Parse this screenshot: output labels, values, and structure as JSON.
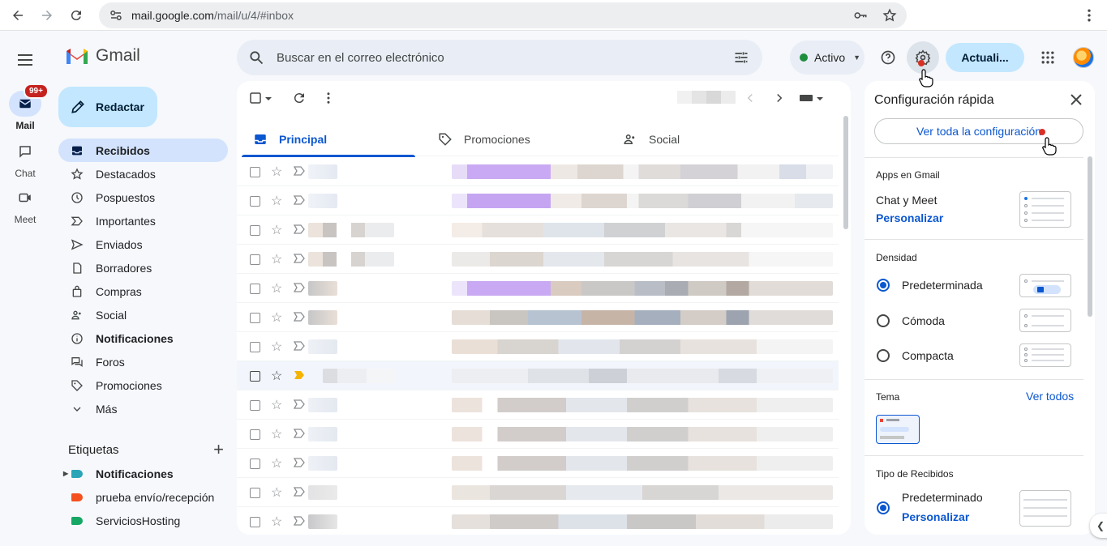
{
  "browser": {
    "url_host": "mail.google.com",
    "url_path": "/mail/u/4/#inbox"
  },
  "rail": {
    "mail_label": "Mail",
    "mail_badge": "99+",
    "chat_label": "Chat",
    "meet_label": "Meet"
  },
  "app": {
    "name": "Gmail",
    "compose_label": "Redactar"
  },
  "nav": {
    "items": [
      {
        "label": "Recibidos",
        "icon": "inbox-icon"
      },
      {
        "label": "Destacados",
        "icon": "star-icon"
      },
      {
        "label": "Pospuestos",
        "icon": "clock-icon"
      },
      {
        "label": "Importantes",
        "icon": "important-icon"
      },
      {
        "label": "Enviados",
        "icon": "send-icon"
      },
      {
        "label": "Borradores",
        "icon": "draft-icon"
      },
      {
        "label": "Compras",
        "icon": "shopping-bag-icon"
      },
      {
        "label": "Social",
        "icon": "people-icon"
      },
      {
        "label": "Notificaciones",
        "icon": "info-icon"
      },
      {
        "label": "Foros",
        "icon": "forum-icon"
      },
      {
        "label": "Promociones",
        "icon": "tag-icon"
      },
      {
        "label": "Más",
        "icon": "chevron-down-icon"
      }
    ]
  },
  "labels": {
    "heading": "Etiquetas",
    "items": [
      {
        "label": "Notificaciones",
        "color": "#2aa5b8"
      },
      {
        "label": "prueba envío/recepción",
        "color": "#f4511e"
      },
      {
        "label": "ServiciosHosting",
        "color": "#16a765"
      }
    ]
  },
  "search": {
    "placeholder": "Buscar en el correo electrónico"
  },
  "status": {
    "label": "Activo"
  },
  "header": {
    "upgrade_label": "Actuali..."
  },
  "tabs": [
    {
      "label": "Principal"
    },
    {
      "label": "Promociones"
    },
    {
      "label": "Social"
    }
  ],
  "quick_settings": {
    "title": "Configuración rápida",
    "see_all": "Ver toda la configuración",
    "apps_heading": "Apps en Gmail",
    "apps_text": "Chat y Meet",
    "apps_link": "Personalizar",
    "density_heading": "Densidad",
    "density_options": [
      "Predeterminada",
      "Cómoda",
      "Compacta"
    ],
    "density_selected": "Predeterminada",
    "theme_heading": "Tema",
    "theme_link": "Ver todos",
    "inbox_type_heading": "Tipo de Recibidos",
    "inbox_type_text": "Predeterminado",
    "inbox_type_link": "Personalizar"
  },
  "colors": {
    "accent": "#0b57d0",
    "compose_bg": "#c2e7ff",
    "active_nav": "#d3e3fd",
    "badge": "#c5221f"
  }
}
